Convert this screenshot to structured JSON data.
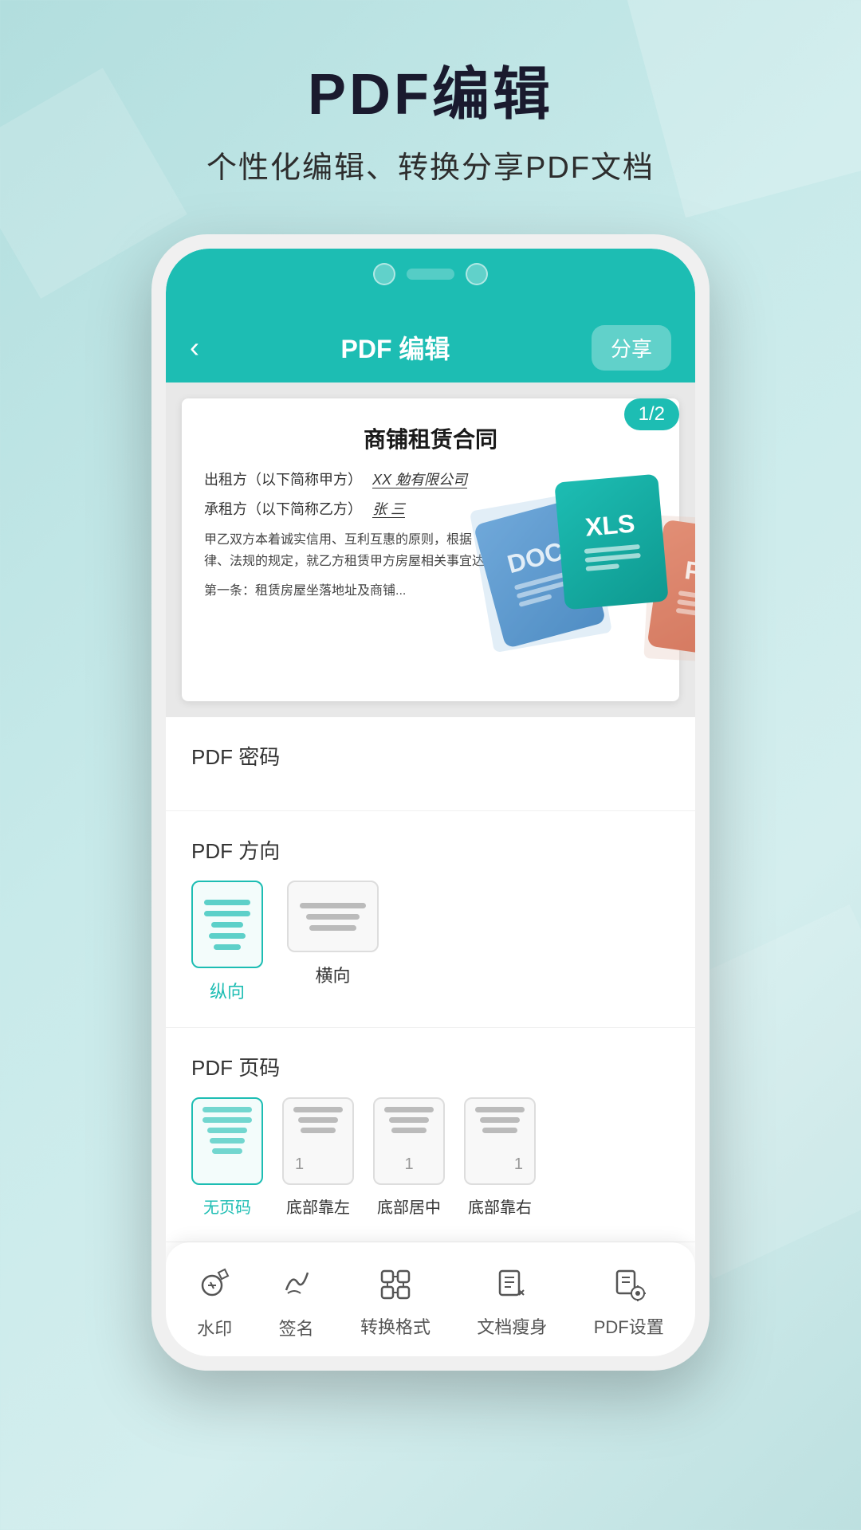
{
  "header": {
    "title": "PDF编辑",
    "subtitle": "个性化编辑、转换分享PDF文档"
  },
  "app_bar": {
    "back_label": "‹",
    "title": "PDF 编辑",
    "share_label": "分享"
  },
  "document": {
    "page_badge": "1/2",
    "title": "商铺租赁合同",
    "line1_label": "出租方（以下简称甲方）",
    "line1_value": "XX 勉有限公司",
    "line2_label": "承租方（以下简称乙方）",
    "line2_value": "张 三",
    "paragraph": "甲乙双方本着诚实信用、互利互惠的原则，根据《中华人民共和国合同法》法律、法规的规定，就乙方租赁甲方房屋相关事宜达成本合同，以兹共同遵守：",
    "paragraph2": "第一条：租赁房屋坐落地址及商铺..."
  },
  "file_formats": [
    {
      "label": "DOC",
      "color": "#2e75b6"
    },
    {
      "label": "XLS",
      "color": "#1dbdb3"
    },
    {
      "label": "PPT",
      "color": "#c94a2a"
    }
  ],
  "settings": {
    "password_section": {
      "title": "PDF 密码"
    },
    "direction_section": {
      "title": "PDF 方向",
      "options": [
        {
          "label": "纵向",
          "active": true
        },
        {
          "label": "横向",
          "active": false
        }
      ]
    },
    "page_number_section": {
      "title": "PDF 页码",
      "options": [
        {
          "label": "无页码",
          "active": true,
          "number_pos": null
        },
        {
          "label": "底部靠左",
          "active": false,
          "number_pos": "left"
        },
        {
          "label": "底部居中",
          "active": false,
          "number_pos": "center"
        },
        {
          "label": "底部靠右",
          "active": false,
          "number_pos": "right"
        }
      ]
    }
  },
  "toolbar": {
    "items": [
      {
        "icon": "🖋",
        "label": "水印",
        "icon_name": "watermark-icon"
      },
      {
        "icon": "✍",
        "label": "签名",
        "icon_name": "signature-icon"
      },
      {
        "icon": "⊞",
        "label": "转换格式",
        "icon_name": "convert-icon"
      },
      {
        "icon": "📄",
        "label": "文档瘦身",
        "icon_name": "compress-icon"
      },
      {
        "icon": "⚙",
        "label": "PDF设置",
        "icon_name": "settings-icon"
      }
    ]
  },
  "colors": {
    "primary": "#1dbdb3",
    "bg": "#c5e8e8"
  }
}
